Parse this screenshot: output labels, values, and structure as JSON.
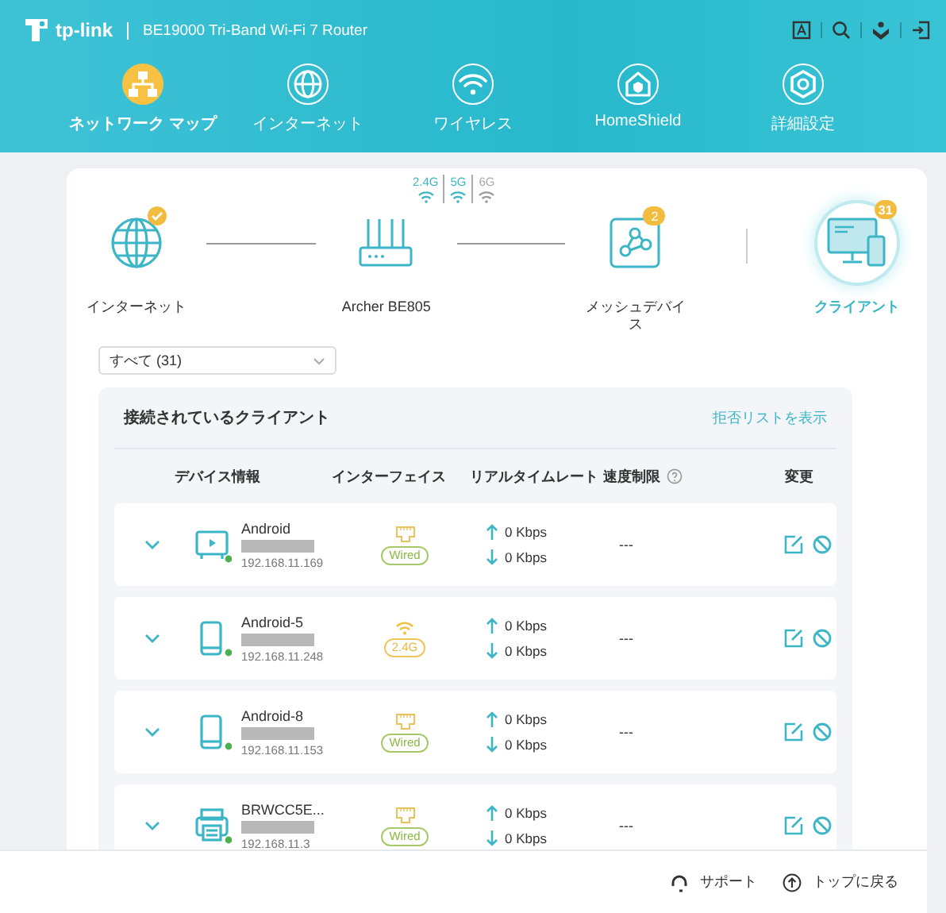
{
  "header": {
    "brand": "tp-link",
    "model": "BE19000 Tri-Band Wi-Fi 7 Router"
  },
  "nav": [
    {
      "label": "ネットワーク マップ",
      "kind": "map",
      "selected": true
    },
    {
      "label": "インターネット",
      "kind": "globe",
      "selected": false
    },
    {
      "label": "ワイヤレス",
      "kind": "wifi",
      "selected": false
    },
    {
      "label": "HomeShield",
      "kind": "home",
      "selected": false
    },
    {
      "label": "詳細設定",
      "kind": "gear",
      "selected": false
    }
  ],
  "topology": {
    "nodes": [
      {
        "label": "インターネット",
        "kind": "internet",
        "connected": true,
        "selected": false
      },
      {
        "label": "Archer BE805",
        "kind": "router",
        "connected": false,
        "selected": false
      },
      {
        "label": "メッシュデバイス",
        "kind": "mesh",
        "badge": "2",
        "connected": false,
        "selected": false
      },
      {
        "label": "クライアント",
        "kind": "clients",
        "badge": "31",
        "connected": false,
        "selected": true
      }
    ],
    "bands": [
      {
        "label": "2.4G",
        "on": true
      },
      {
        "label": "5G",
        "on": true
      },
      {
        "label": "6G",
        "on": false
      }
    ]
  },
  "filter": {
    "value": "すべて (31)"
  },
  "clients": {
    "title": "接続されているクライアント",
    "link": "拒否リストを表示",
    "columns": [
      "デバイス情報",
      "インターフェイス",
      "リアルタイムレート",
      "速度制限",
      "変更"
    ],
    "rows": [
      {
        "kind": "tv",
        "name": "Android",
        "ip": "192.168.11.169",
        "interface": {
          "kind": "wired",
          "label": "Wired"
        },
        "up": "0 Kbps",
        "down": "0 Kbps",
        "limit": "---"
      },
      {
        "kind": "phone",
        "name": "Android-5",
        "ip": "192.168.11.248",
        "interface": {
          "kind": "wifi",
          "label": "2.4G"
        },
        "up": "0 Kbps",
        "down": "0 Kbps",
        "limit": "---"
      },
      {
        "kind": "phone",
        "name": "Android-8",
        "ip": "192.168.11.153",
        "interface": {
          "kind": "wired",
          "label": "Wired"
        },
        "up": "0 Kbps",
        "down": "0 Kbps",
        "limit": "---"
      },
      {
        "kind": "printer",
        "name": "BRWCC5E...",
        "ip": "192.168.11.3",
        "interface": {
          "kind": "wired",
          "label": "Wired"
        },
        "up": "0 Kbps",
        "down": "0 Kbps",
        "limit": "---"
      }
    ]
  },
  "footer": {
    "support": "サポート",
    "top": "トップに戻る"
  }
}
